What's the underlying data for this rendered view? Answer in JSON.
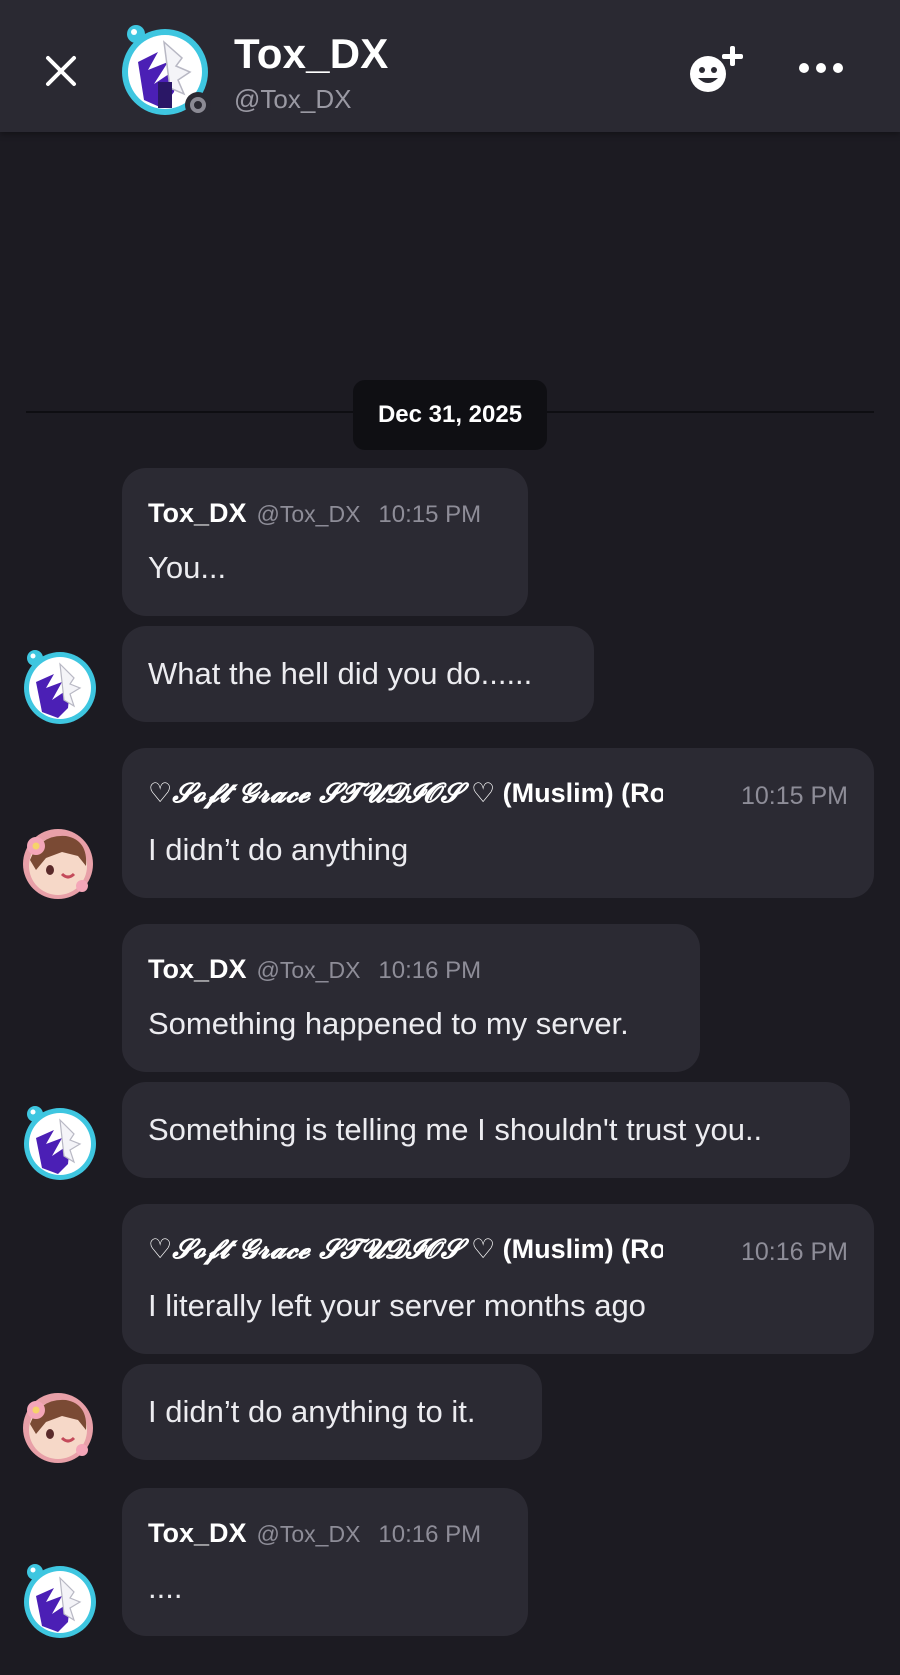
{
  "header": {
    "title": "Tox_DX",
    "handle": "@Tox_DX",
    "icons": [
      "close-icon",
      "add-friend-icon",
      "more-icon"
    ]
  },
  "divider": {
    "date": "Dec 31, 2025"
  },
  "messages": [
    {
      "user": "Tox_DX",
      "handle": "@Tox_DX",
      "time": "10:15 PM",
      "text": "You..."
    },
    {
      "text": "What the hell did you do......"
    },
    {
      "user_script": "♡𝓢𝓸𝓯𝓽 𝓖𝓻𝓪𝓬𝓮 𝓢𝓣𝓤𝓓𝓘𝓞𝓢 ♡",
      "user_suffix": " (Muslim) (Ro",
      "time": "10:15 PM",
      "text": "I didn’t do anything"
    },
    {
      "user": "Tox_DX",
      "handle": "@Tox_DX",
      "time": "10:16 PM",
      "text": "Something happened to my server."
    },
    {
      "text": "Something is telling me I shouldn't trust you.."
    },
    {
      "user_script": "♡𝓢𝓸𝓯𝓽 𝓖𝓻𝓪𝓬𝓮 𝓢𝓣𝓤𝓓𝓘𝓞𝓢 ♡",
      "user_suffix": " (Muslim) (Ro",
      "time": "10:16 PM",
      "text": "I literally left your server months ago"
    },
    {
      "text": "I didn’t do anything to it."
    },
    {
      "user": "Tox_DX",
      "handle": "@Tox_DX",
      "time": "10:16 PM",
      "text": "...."
    }
  ],
  "colors": {
    "background": "#1c1b22",
    "header": "#2a2932",
    "bubble": "#2b2a33",
    "avatar_ring": "#3ec6e0",
    "accent_purple": "#4b1fb5"
  }
}
